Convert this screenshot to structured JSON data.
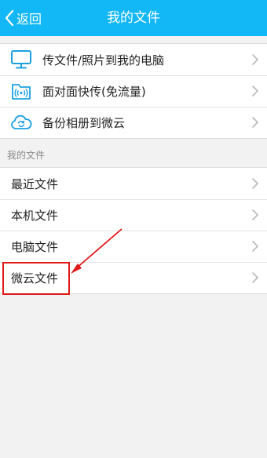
{
  "header": {
    "back_label": "返回",
    "title": "我的文件",
    "background": "#12b7f5"
  },
  "actions": [
    {
      "label": "传文件/照片到我的电脑",
      "icon": "computer-icon"
    },
    {
      "label": "面对面快传(免流量)",
      "icon": "wireless-transfer-icon"
    },
    {
      "label": "备份相册到微云",
      "icon": "cloud-sync-icon"
    }
  ],
  "section_title": "我的文件",
  "files": [
    {
      "label": "最近文件"
    },
    {
      "label": "本机文件"
    },
    {
      "label": "电脑文件"
    },
    {
      "label": "微云文件",
      "highlighted": true
    }
  ],
  "colors": {
    "accent": "#12b7f5",
    "annotation": "#e01a1a"
  }
}
